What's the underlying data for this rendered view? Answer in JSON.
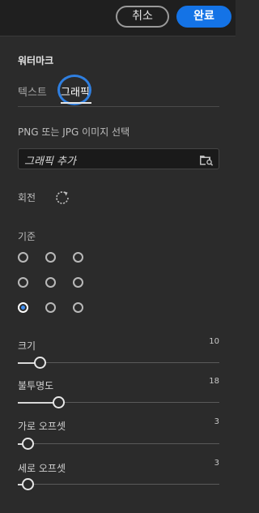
{
  "header": {
    "cancel_label": "취소",
    "done_label": "완료",
    "accent": "#1473e6"
  },
  "panel": {
    "title": "워터마크",
    "tabs": [
      {
        "label": "텍스트"
      },
      {
        "label": "그래픽",
        "selected": true
      }
    ]
  },
  "graphic": {
    "select_label": "PNG 또는 JPG 이미지 선택",
    "add_placeholder": "그래픽 추가",
    "folder_icon": "folder-search-icon"
  },
  "rotation": {
    "label": "회전",
    "icon": "rotate-icon"
  },
  "anchor": {
    "label": "기준",
    "selected": "bottom-left",
    "positions": [
      "top-left",
      "top-center",
      "top-right",
      "middle-left",
      "middle-center",
      "middle-right",
      "bottom-left",
      "bottom-center",
      "bottom-right"
    ]
  },
  "sliders": [
    {
      "key": "size",
      "label": "크기",
      "value": "10",
      "fill_fraction": 0.11
    },
    {
      "key": "opacity",
      "label": "불투명도",
      "value": "18",
      "fill_fraction": 0.2
    },
    {
      "key": "horizontal_offset",
      "label": "가로 오프셋",
      "value": "3",
      "fill_fraction": 0.05
    },
    {
      "key": "vertical_offset",
      "label": "세로 오프셋",
      "value": "3",
      "fill_fraction": 0.05
    }
  ]
}
